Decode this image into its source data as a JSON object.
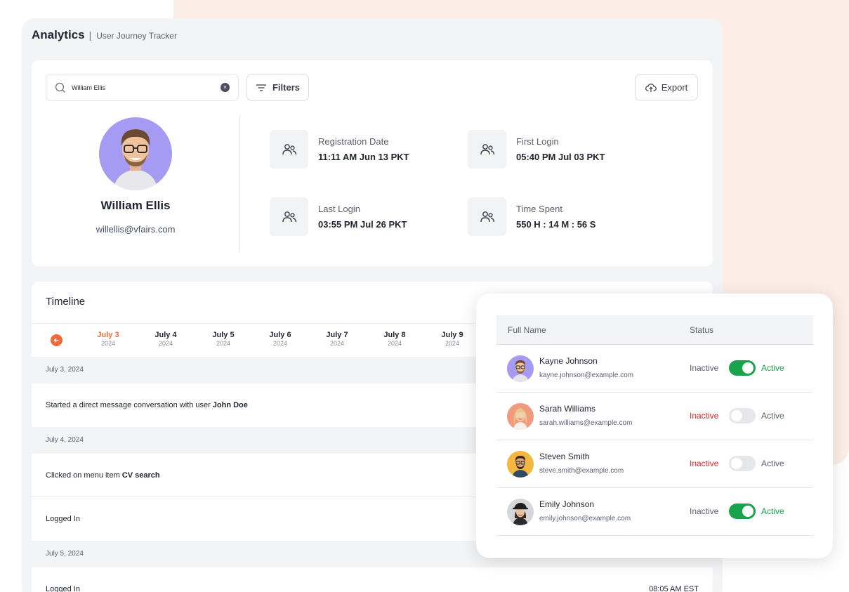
{
  "app": {
    "title": "Analytics",
    "separator": "|",
    "subtitle": "User Journey Tracker"
  },
  "search": {
    "value": "William Ellis",
    "placeholder": "Search"
  },
  "toolbar": {
    "filters_label": "Filters",
    "export_label": "Export"
  },
  "profile": {
    "name": "William Ellis",
    "email": "willellis@vfairs.com",
    "stats": [
      {
        "label": "Registration Date",
        "value": "11:11 AM Jun 13 PKT",
        "icon": "users-icon"
      },
      {
        "label": "First Login",
        "value": "05:40 PM Jul 03 PKT",
        "icon": "users-icon"
      },
      {
        "label": "Last Login",
        "value": "03:55 PM Jul 26 PKT",
        "icon": "users-icon"
      },
      {
        "label": "Time Spent",
        "value": "550 H : 14 M : 56 S",
        "icon": "users-icon"
      }
    ]
  },
  "timeline": {
    "title": "Timeline",
    "dates": [
      {
        "day": "July 3",
        "year": "2024",
        "active": true
      },
      {
        "day": "July 4",
        "year": "2024",
        "active": false
      },
      {
        "day": "July 5",
        "year": "2024",
        "active": false
      },
      {
        "day": "July 6",
        "year": "2024",
        "active": false
      },
      {
        "day": "July 7",
        "year": "2024",
        "active": false
      },
      {
        "day": "July 8",
        "year": "2024",
        "active": false
      },
      {
        "day": "July 9",
        "year": "2024",
        "active": false
      }
    ],
    "groups": [
      {
        "date": "July 3, 2024"
      },
      {
        "date": "July 4, 2024"
      },
      {
        "date": "July 5, 2024"
      }
    ],
    "events": [
      {
        "text": "Started a direct message conversation with user",
        "bold": "John Doe",
        "time": ""
      },
      {
        "text": "Clicked on menu item",
        "bold": "CV search",
        "time": ""
      },
      {
        "text": "Logged In",
        "bold": "",
        "time": ""
      },
      {
        "text": "Logged In",
        "bold": "",
        "time": "08:05 AM EST"
      }
    ]
  },
  "user_table": {
    "headers": {
      "name": "Full Name",
      "status": "Status"
    },
    "inactive_label": "Inactive",
    "active_label": "Active",
    "rows": [
      {
        "name": "Kayne Johnson",
        "email": "kayne.johnson@example.com",
        "active": true
      },
      {
        "name": "Sarah Williams",
        "email": "sarah.williams@example.com",
        "active": false
      },
      {
        "name": "Steven Smith",
        "email": "steve.smith@example.com",
        "active": false
      },
      {
        "name": "Emily Johnson",
        "email": "emily.johnson@example.com",
        "active": true
      }
    ]
  },
  "colors": {
    "accent": "#ef6a3a",
    "active_green": "#16a34a",
    "inactive_red": "#e02424",
    "background_blob": "#fcede7"
  }
}
